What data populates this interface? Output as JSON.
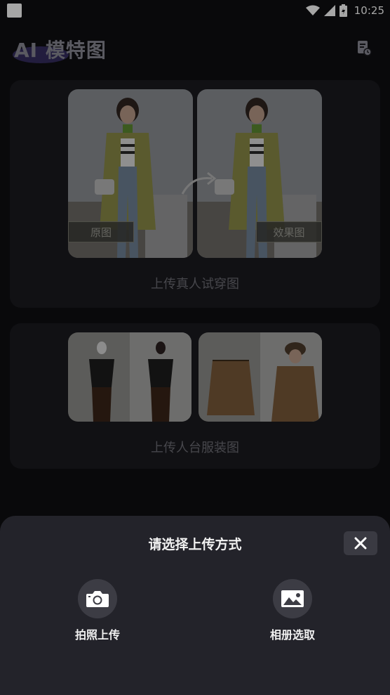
{
  "status_bar": {
    "time": "10:25"
  },
  "header": {
    "title": "AI 模特图"
  },
  "cards": {
    "real_person": {
      "original_label": "原图",
      "result_label": "效果图",
      "caption": "上传真人试穿图"
    },
    "mannequin": {
      "caption": "上传人台服装图"
    }
  },
  "upload_sheet": {
    "title": "请选择上传方式",
    "options": [
      {
        "label": "拍照上传",
        "icon": "camera-icon"
      },
      {
        "label": "相册选取",
        "icon": "image-icon"
      }
    ]
  }
}
